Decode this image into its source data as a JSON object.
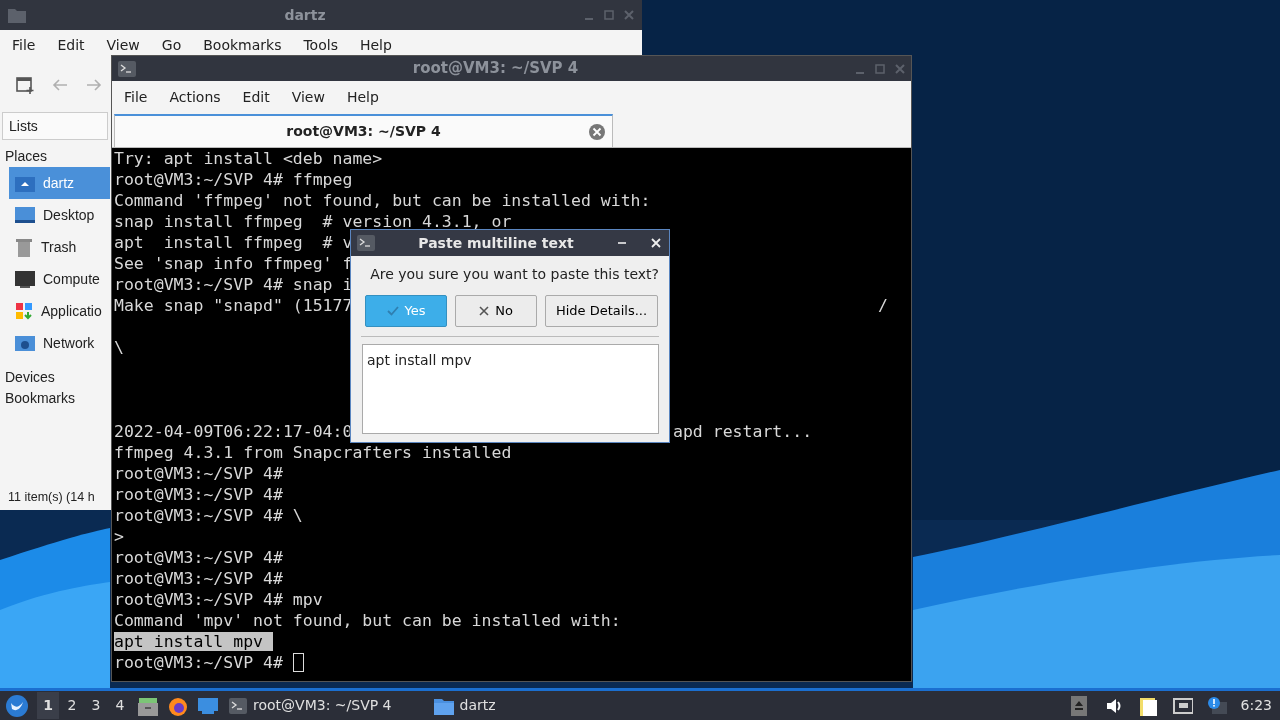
{
  "file_manager": {
    "title": "dartz",
    "menu": [
      "File",
      "Edit",
      "View",
      "Go",
      "Bookmarks",
      "Tools",
      "Help"
    ],
    "toolbar": [
      {
        "kind": "new-tab",
        "disabled": false
      },
      {
        "kind": "back",
        "disabled": true
      },
      {
        "kind": "forward",
        "disabled": true
      }
    ],
    "side_tab": "Lists",
    "sections": [
      {
        "label": "Places",
        "items": [
          {
            "label": "dartz",
            "kind": "home",
            "selected": true
          },
          {
            "label": "Desktop",
            "kind": "desktop",
            "selected": false
          },
          {
            "label": "Trash",
            "kind": "trash",
            "selected": false
          },
          {
            "label": "Compute",
            "kind": "computer",
            "selected": false
          },
          {
            "label": "Applicatio",
            "kind": "apps",
            "selected": false
          },
          {
            "label": "Network",
            "kind": "network",
            "selected": false
          }
        ]
      },
      {
        "label": "Devices"
      },
      {
        "label": "Bookmarks"
      }
    ],
    "status": "11 item(s) (14 h"
  },
  "terminal": {
    "title": "root@VM3: ~/SVP 4",
    "menu": [
      "File",
      "Actions",
      "Edit",
      "View",
      "Help"
    ],
    "tabs": [
      {
        "label": "root@VM3: ~/SVP 4",
        "selected": true
      }
    ],
    "lines": [
      {
        "kind": "text",
        "text": "Try: apt install <deb name>",
        "highlighted": false,
        "cursor": false
      },
      {
        "kind": "text",
        "text": "root@VM3:~/SVP 4# ffmpeg",
        "highlighted": false,
        "cursor": false
      },
      {
        "kind": "text",
        "text": "Command 'ffmpeg' not found, but can be installed with:",
        "highlighted": false,
        "cursor": false
      },
      {
        "kind": "text",
        "text": "snap install ffmpeg  # version 4.3.1, or",
        "highlighted": false,
        "cursor": false
      },
      {
        "kind": "text",
        "text": "apt  install ffmpeg  # v",
        "highlighted": false,
        "cursor": false
      },
      {
        "kind": "text",
        "text": "See 'snap info ffmpeg' f",
        "highlighted": false,
        "cursor": false
      },
      {
        "kind": "text",
        "text": "root@VM3:~/SVP 4# snap i",
        "highlighted": false,
        "cursor": false
      },
      {
        "kind": "text",
        "text": "Make snap \"snapd\" (15177",
        "highlighted": false,
        "cursor": false,
        "tail": {
          "text": "/",
          "kind": "far-right"
        }
      },
      {
        "kind": "blank"
      },
      {
        "kind": "text",
        "text": "\\",
        "highlighted": false,
        "cursor": false
      },
      {
        "kind": "blank"
      },
      {
        "kind": "blank"
      },
      {
        "kind": "blank"
      },
      {
        "kind": "text",
        "text": "2022-04-09T06:22:17-04:0",
        "highlighted": false,
        "cursor": false,
        "tail": {
          "text": "apd restart...",
          "kind": "after-dialog"
        }
      },
      {
        "kind": "text",
        "text": "ffmpeg 4.3.1 from Snapcrafters installed",
        "highlighted": false,
        "cursor": false
      },
      {
        "kind": "text",
        "text": "root@VM3:~/SVP 4#",
        "highlighted": false,
        "cursor": false
      },
      {
        "kind": "text",
        "text": "root@VM3:~/SVP 4#",
        "highlighted": false,
        "cursor": false
      },
      {
        "kind": "text",
        "text": "root@VM3:~/SVP 4# \\",
        "highlighted": false,
        "cursor": false
      },
      {
        "kind": "text",
        "text": ">",
        "highlighted": false,
        "cursor": false
      },
      {
        "kind": "text",
        "text": "root@VM3:~/SVP 4#",
        "highlighted": false,
        "cursor": false
      },
      {
        "kind": "text",
        "text": "root@VM3:~/SVP 4#",
        "highlighted": false,
        "cursor": false
      },
      {
        "kind": "text",
        "text": "root@VM3:~/SVP 4# mpv",
        "highlighted": false,
        "cursor": false
      },
      {
        "kind": "text",
        "text": "Command 'mpv' not found, but can be installed with:",
        "highlighted": false,
        "cursor": false
      },
      {
        "kind": "text",
        "text": "apt install mpv",
        "highlighted": true,
        "cursor": false
      },
      {
        "kind": "text",
        "text": "root@VM3:~/SVP 4#",
        "highlighted": false,
        "cursor": true
      }
    ]
  },
  "dialog": {
    "title": "Paste multiline text",
    "question": "Are you sure you want to paste this text?",
    "buttons": [
      {
        "label": "Yes",
        "kind": "confirm",
        "default": true
      },
      {
        "label": "No",
        "kind": "cancel",
        "default": false
      },
      {
        "label": "Hide Details...",
        "kind": "plain",
        "default": false
      }
    ],
    "details": "apt install mpv"
  },
  "taskbar": {
    "workspaces": [
      {
        "label": "1",
        "selected": true
      },
      {
        "label": "2",
        "selected": false
      },
      {
        "label": "3",
        "selected": false
      },
      {
        "label": "4",
        "selected": false
      }
    ],
    "launchers": [
      {
        "kind": "files"
      },
      {
        "kind": "browser"
      },
      {
        "kind": "desktop"
      }
    ],
    "tasks": [
      {
        "label": "root@VM3: ~/SVP 4",
        "kind": "terminal"
      },
      {
        "label": "dartz",
        "kind": "folder"
      }
    ],
    "tray": [
      {
        "kind": "eject"
      },
      {
        "kind": "speaker"
      },
      {
        "kind": "clipboard"
      },
      {
        "kind": "network"
      },
      {
        "kind": "notification"
      }
    ],
    "clock": "6:23"
  }
}
